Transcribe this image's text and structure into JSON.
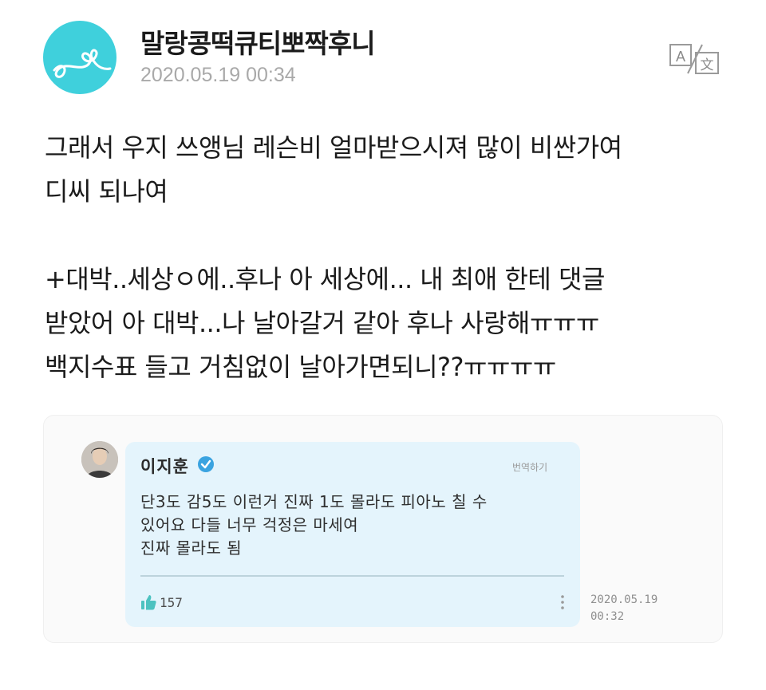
{
  "post": {
    "username": "말랑콩떡큐티뽀짝후니",
    "timestamp": "2020.05.19 00:34",
    "translate_icon": "translate-icon",
    "lines": [
      "그래서 우지 쓰앵님 레슨비 얼마받으시져 많이 비싼가여",
      "디씨 되나여",
      "",
      "+대박..세상ㅇ에..후나 아 세상에... 내 최애 한테 댓글",
      "받았어 아 대박...나 날아갈거 같아 후나 사랑해ㅠㅠㅠ",
      "백지수표 들고 거침없이 날아가면되니??ㅠㅠㅠㅠ"
    ]
  },
  "comment": {
    "author": "이지훈",
    "verified_icon": "verified-badge-icon",
    "translate_label": "번역하기",
    "lines": [
      "단3도 감5도 이런거 진짜 1도 몰라도 피아노 칠 수",
      "있어요 다들 너무 걱정은 마세여",
      "진짜 몰라도 됨"
    ],
    "like_icon": "thumbs-up-icon",
    "likes": "157",
    "more_icon": "more-vertical-icon",
    "date_line1": "2020.05.19",
    "date_line2": "00:32"
  },
  "colors": {
    "avatar_bg": "#3fd0dc",
    "bubble_bg": "#e4f4fc",
    "verified": "#3aa3e0",
    "like": "#4cc2c0"
  }
}
